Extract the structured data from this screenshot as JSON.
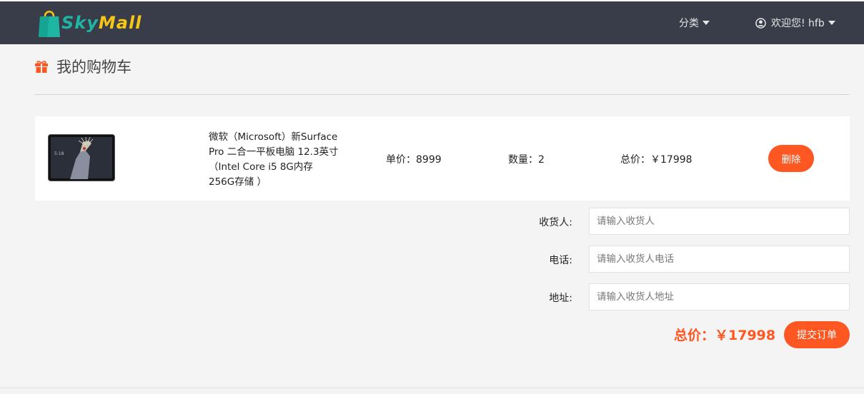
{
  "header": {
    "brand_part1": "Sky",
    "brand_part2": "Mall",
    "category_label": "分类",
    "user_label": "欢迎您! hfb"
  },
  "page": {
    "title": "我的购物车"
  },
  "cart_item": {
    "name": "微软（Microsoft）新Surface Pro 二合一平板电脑 12.3英寸（Intel Core i5 8G内存 256G存储 ）",
    "unit_price": "单价：8999",
    "quantity": "数量：2",
    "total": "总价：￥17998",
    "delete_label": "删除"
  },
  "form": {
    "receiver_label": "收货人:",
    "receiver_placeholder": "请输入收货人",
    "phone_label": "电话:",
    "phone_placeholder": "请输入收货人电话",
    "address_label": "地址:",
    "address_placeholder": "请输入收货人地址"
  },
  "summary": {
    "total": "总价：￥17998",
    "submit_label": "提交订单"
  },
  "colors": {
    "accent": "#fe5722",
    "navbar": "#393d49",
    "background": "#f4f4f4"
  }
}
